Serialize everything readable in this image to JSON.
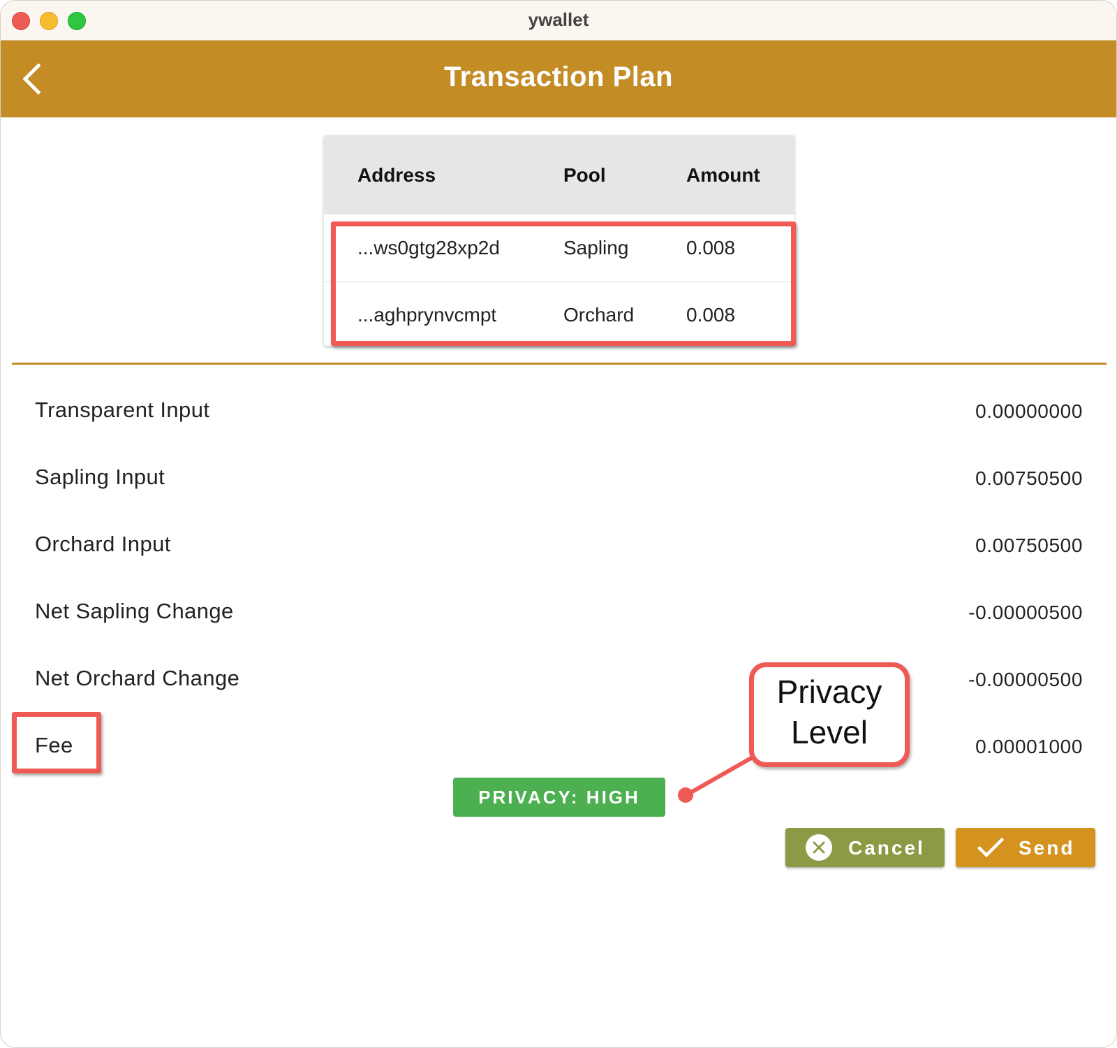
{
  "window": {
    "title": "ywallet"
  },
  "appbar": {
    "title": "Transaction Plan",
    "back_icon": "chevron-left-icon"
  },
  "table": {
    "headers": {
      "address": "Address",
      "pool": "Pool",
      "amount": "Amount"
    },
    "rows": [
      {
        "address": "...ws0gtg28xp2d",
        "pool": "Sapling",
        "amount": "0.008"
      },
      {
        "address": "...aghprynvcmpt",
        "pool": "Orchard",
        "amount": "0.008"
      }
    ]
  },
  "summary": [
    {
      "label": "Transparent Input",
      "value": "0.00000000"
    },
    {
      "label": "Sapling Input",
      "value": "0.00750500"
    },
    {
      "label": "Orchard Input",
      "value": "0.00750500"
    },
    {
      "label": "Net Sapling Change",
      "value": "-0.00000500"
    },
    {
      "label": "Net Orchard Change",
      "value": "-0.00000500"
    },
    {
      "label": "Fee",
      "value": "0.00001000"
    }
  ],
  "privacy": {
    "badge": "PRIVACY: HIGH"
  },
  "annotation": {
    "line1": "Privacy",
    "line2": "Level"
  },
  "buttons": {
    "cancel": {
      "label": "Cancel",
      "icon": "x-circle-icon"
    },
    "send": {
      "label": "Send",
      "icon": "check-icon"
    }
  },
  "colors": {
    "appbar": "#c48c25",
    "privacy_badge": "#4caf50",
    "cancel_button": "#8c9a45",
    "send_button": "#d4931f",
    "annotation": "#f05a54"
  }
}
